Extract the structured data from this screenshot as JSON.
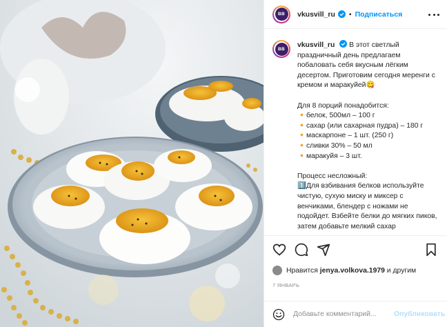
{
  "post": {
    "author": {
      "username": "vkusvill_ru",
      "avatar_text": "BB",
      "verified_icon": "verified-badge-icon",
      "follow_label": "Подписаться",
      "follow_separator": "•"
    },
    "caption": {
      "text": "В этот светлый праздничный день предлагаем побаловать себя вкусным лёгким десертом. Приготовим сегодня меренги с кремом и маракуйей😋\n\nДля 8 порций понадобится:\n🔸белок, 500мл – 100 г\n🔸сахар (или сахарная пудра) – 180 г\n🔸маскарпоне – 1 шт. (250 г)\n🔸сливки 30% – 50 мл\n🔸маракуйя – 3 шт.\n\nПроцесс несложный:\n1️⃣Для взбивания белков используйте чистую, сухую миску и миксер с венчиками, блендер с ножами не подойдет. Взбейте белки до мягких пиков, затем добавьте мелкий сахар"
    },
    "actions": {
      "like_icon": "heart-icon",
      "comment_icon": "comment-icon",
      "share_icon": "share-icon",
      "save_icon": "bookmark-icon"
    },
    "likes": {
      "prefix": "Нравится",
      "user": "jenya.volkova.1979",
      "suffix": "и другим"
    },
    "date": "7 ЯНВАРЬ",
    "comment_box": {
      "emoji_icon": "emoji-icon",
      "placeholder": "Добавьте комментарий...",
      "publish_label": "Опубликовать"
    }
  },
  "colors": {
    "accent": "#0095f6",
    "publish_disabled": "#b3dffc",
    "text": "#262626",
    "muted": "#8e8e8e",
    "avatar_bg": "#3d1f66"
  }
}
